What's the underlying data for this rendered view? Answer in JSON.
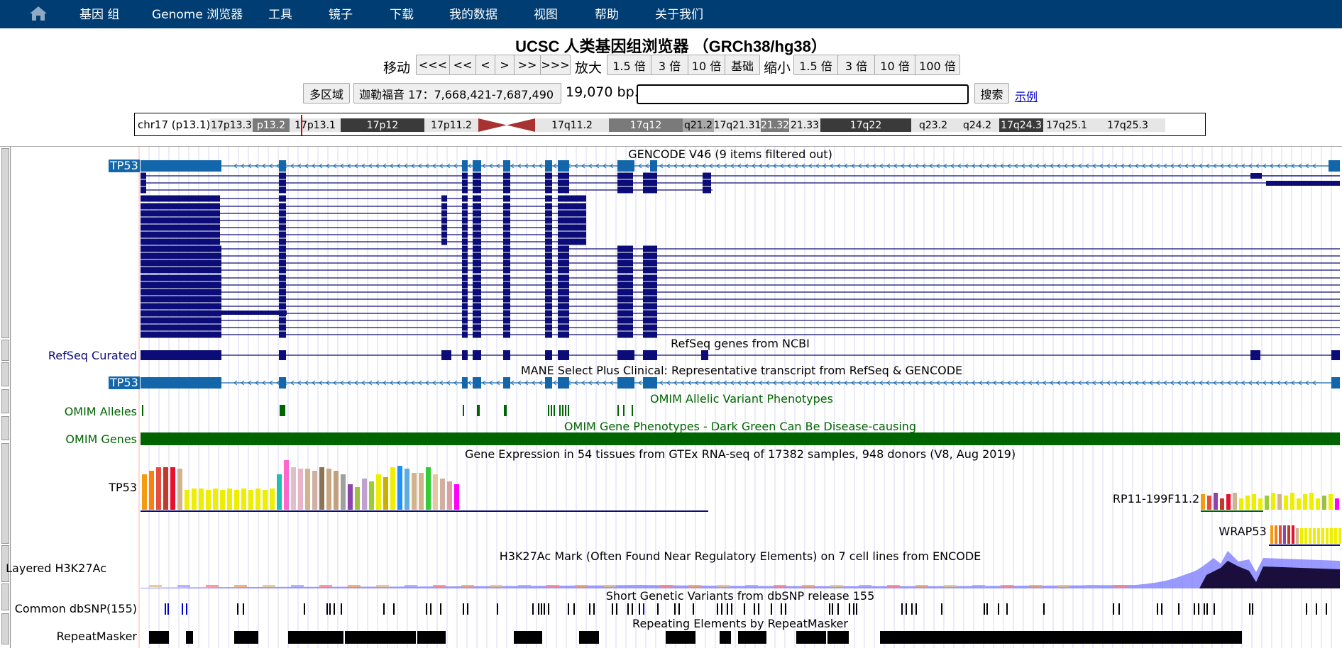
{
  "nav": {
    "home_icon": "home-icon",
    "items": [
      "基因 组",
      "Genome 浏览器",
      "工具",
      "镜子",
      "下载",
      "我的数据",
      "视图",
      "帮助",
      "关于我们"
    ]
  },
  "title": "UCSC 人类基因组浏览器 （GRCh38/hg38）",
  "controls": {
    "move_label": "移动",
    "move_buttons": [
      "<<<",
      "<<",
      "<",
      ">",
      ">>",
      ">>>"
    ],
    "zoom_in_label": "放大",
    "zoom_in_buttons": [
      "1.5 倍",
      "3 倍",
      "10 倍",
      "基础"
    ],
    "zoom_out_label": "缩小",
    "zoom_out_buttons": [
      "1.5 倍",
      "3 倍",
      "10 倍",
      "100 倍"
    ],
    "multi_region": "多区域",
    "position": "迦勒福音 17：7,668,421-7,687,490",
    "bp": "19,070 bp.",
    "search_value": "",
    "search_button": "搜索",
    "examples": "示例"
  },
  "ideogram": {
    "chrom": "chr17 (p13.1)",
    "bands": [
      {
        "name": "17p13.3",
        "shade": "light"
      },
      {
        "name": "p13.2",
        "shade": "mid"
      },
      {
        "name": "17p13.1",
        "shade": "light"
      },
      {
        "name": "17p12",
        "shade": "dark"
      },
      {
        "name": "17p11.2",
        "shade": "light"
      },
      {
        "name": "",
        "shade": "centromere"
      },
      {
        "name": "17q11.2",
        "shade": "light"
      },
      {
        "name": "17q12",
        "shade": "mid"
      },
      {
        "name": "q21.2",
        "shade": "midlight"
      },
      {
        "name": "17q21.31",
        "shade": "light"
      },
      {
        "name": "21.32",
        "shade": "mid"
      },
      {
        "name": "21.33",
        "shade": "light"
      },
      {
        "name": "17q22",
        "shade": "dark"
      },
      {
        "name": "q23.2",
        "shade": "light"
      },
      {
        "name": "q24.2",
        "shade": "light"
      },
      {
        "name": "17q24.3",
        "shade": "dark"
      },
      {
        "name": "17q25.1",
        "shade": "light"
      },
      {
        "name": "17q25.3",
        "shade": "light"
      }
    ],
    "colors": {
      "light": "#e6e6e6",
      "midlight": "#a8a8a8",
      "mid": "#7a7a7a",
      "dark": "#3a3a3a",
      "centromere": "#a83232",
      "highlight": "#e00000"
    }
  },
  "tracks": {
    "gencode": {
      "label": "TP53",
      "title": "GENCODE V46 (9 items filtered out)",
      "color": "#0c0c78",
      "highlight": "#1466aa"
    },
    "refseq": {
      "label": "RefSeq Curated",
      "title": "RefSeq genes from NCBI",
      "color": "#0c0c78"
    },
    "mane": {
      "label": "TP53",
      "title": "MANE Select Plus Clinical: Representative transcript from RefSeq & GENCODE"
    },
    "omim_alleles": {
      "label": "OMIM Alleles",
      "title": "OMIM Allelic Variant Phenotypes",
      "color": "#006400"
    },
    "omim_genes": {
      "label": "OMIM Genes",
      "title": "OMIM Gene Phenotypes - Dark Green Can Be Disease-causing",
      "color": "#006400"
    },
    "gtex": {
      "title": "Gene Expression in 54 tissues from GTEx RNA-seq of 17382 samples, 948 donors (V8, Aug 2019)",
      "genes": [
        "TP53",
        "RP11-199F11.2",
        "WRAP53"
      ]
    },
    "h3k27ac": {
      "label": "Layered H3K27Ac",
      "title": "H3K27Ac Mark (Often Found Near Regulatory Elements) on 7 cell lines from ENCODE"
    },
    "dbsnp": {
      "label": "Common dbSNP(155)",
      "title": "Short Genetic Variants from dbSNP release 155"
    },
    "repeatmasker": {
      "label": "RepeatMasker",
      "title": "Repeating Elements by RepeatMasker"
    }
  }
}
